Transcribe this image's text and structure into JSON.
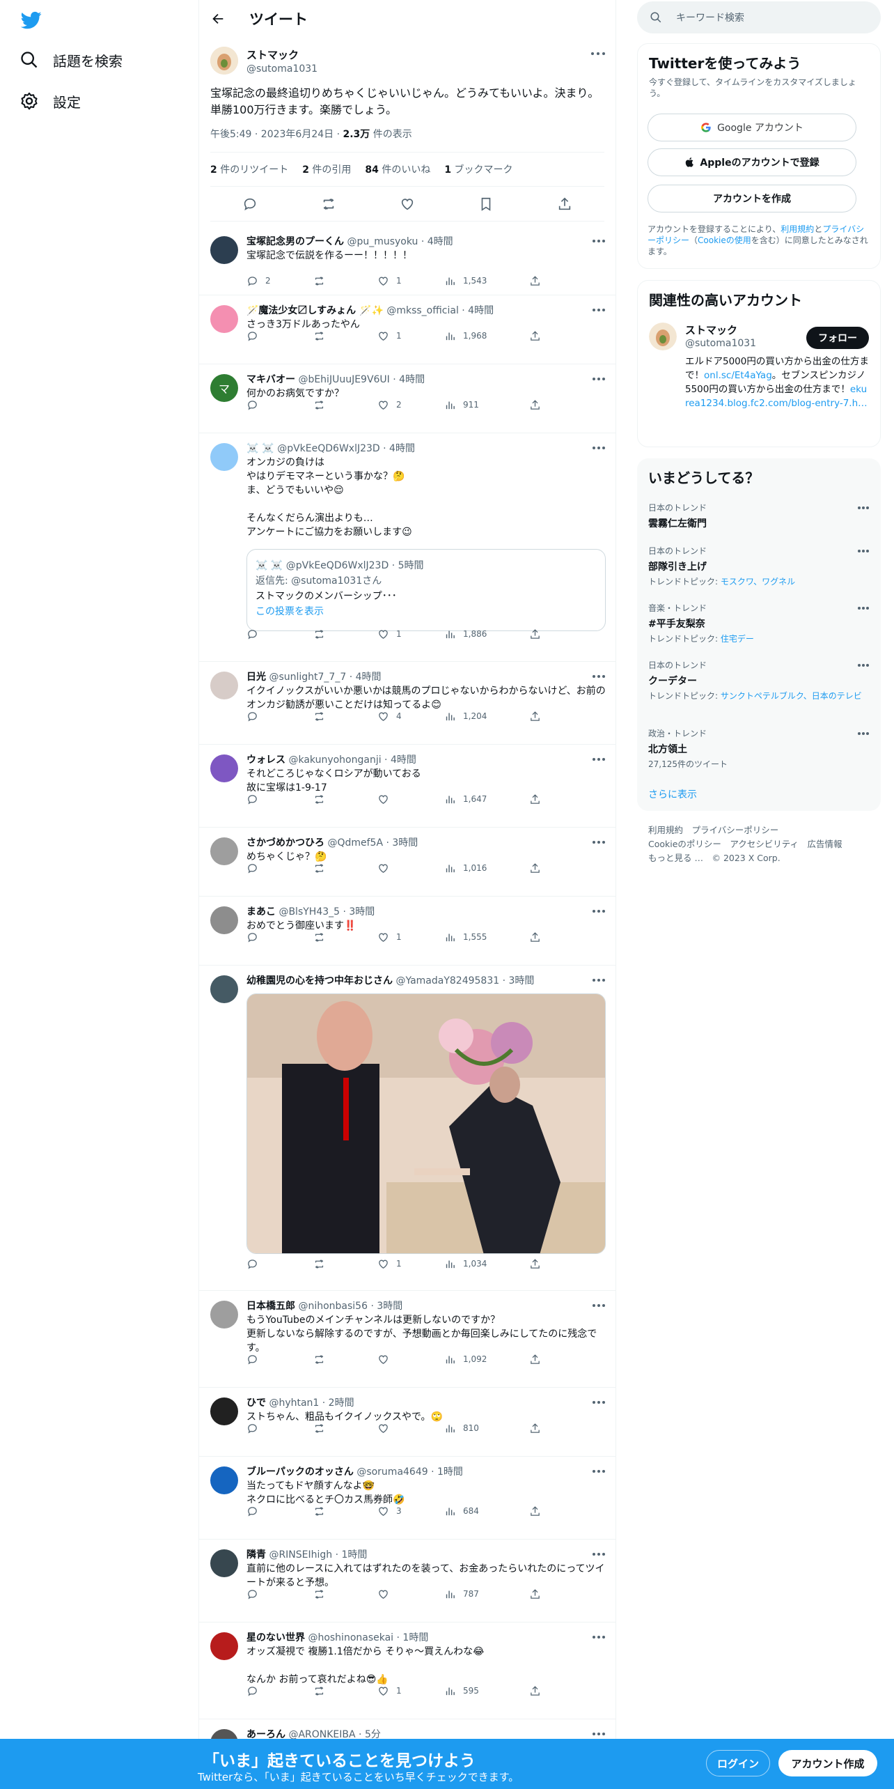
{
  "nav": {
    "explore": "話題を検索",
    "settings": "設定"
  },
  "header": {
    "title": "ツイート"
  },
  "focal": {
    "name": "ストマック",
    "handle": "@sutoma1031",
    "text": "宝塚記念の最終追切りめちゃくじゃいいじゃん。どうみてもいいよ。決まり。単勝100万行きます。楽勝でしょう。",
    "time": "午後5:49 · 2023年6月24日 · ",
    "views_num": "2.3万",
    "views_label": " 件の表示",
    "retweets_num": "2",
    "retweets_label": " 件のリツイート",
    "quotes_num": "2",
    "quotes_label": " 件の引用",
    "likes_num": "84",
    "likes_label": " 件のいいね",
    "bookmarks_num": "1",
    "bookmarks_label": " ブックマーク"
  },
  "replies": [
    {
      "name": "宝塚記念男のプーくん",
      "handle": "@pu_musyoku · 4時間",
      "text": "宝塚記念で伝説を作るーー！！！！！",
      "replies": "2",
      "likes": "1",
      "views": "1,543",
      "avatar_color": "#2c3e50"
    },
    {
      "name": "🪄魔法少女〼しすみょん 🪄✨",
      "handle": "@mkss_official · 4時間",
      "text": "さっき3万ドルあったやん",
      "replies": "",
      "likes": "1",
      "views": "1,968",
      "avatar_color": "#f48fb1"
    },
    {
      "name": "マキバオー",
      "handle": "@bEhiJUuuJE9V6UI · 4時間",
      "text": "何かのお病気ですか？",
      "replies": "",
      "likes": "2",
      "views": "911",
      "avatar_color": "#2e7d32",
      "avatar_letter": "マ"
    },
    {
      "name": "☠️ ☠️",
      "handle": "@pVkEeQD6WxlJ23D · 4時間",
      "text": "オンカジの負けは\nやはりデモマネーという事かな？🤔\nま、どうでもいいや😌\n\nそんなくだらん演出よりも…\nアンケートにご協力をお願いします😉",
      "replies": "",
      "likes": "1",
      "views": "1,886",
      "avatar_color": "#90caf9",
      "quote": {
        "head": "☠️ ☠️ @pVkEeQD6WxlJ23D · 5時間",
        "reply_to": "返信先: @sutoma1031さん",
        "text": "ストマックのメンバーシップ･･･",
        "link": "この投票を表示"
      }
    },
    {
      "name": "日光",
      "handle": "@sunlight7_7_7 · 4時間",
      "text": "イクイノックスがいいか悪いかは競馬のプロじゃないからわからないけど、お前のオンカジ勧誘が悪いことだけは知ってるよ😊",
      "replies": "",
      "likes": "4",
      "views": "1,204",
      "avatar_color": "#d7ccc8"
    },
    {
      "name": "ウォレス",
      "handle": "@kakunyohonganji · 4時間",
      "text": "それどころじゃなくロシアが動いておる\n故に宝塚は1-9-17",
      "replies": "",
      "likes": "",
      "views": "1,647",
      "avatar_color": "#7e57c2"
    },
    {
      "name": "さかづめかつひろ",
      "handle": "@Qdmef5A · 3時間",
      "text": "めちゃくじゃ？🤔",
      "replies": "",
      "likes": "",
      "views": "1,016",
      "avatar_color": "#9e9e9e"
    },
    {
      "name": "まあこ",
      "handle": "@BlsYH43_5 · 3時間",
      "text": "おめでとう御座います‼️",
      "replies": "",
      "likes": "1",
      "views": "1,555",
      "avatar_color": "#8d8d8d"
    },
    {
      "name": "幼稚園児の心を持つ中年おじさん",
      "handle": "@YamadaY82495831 · 3時間",
      "text": "",
      "replies": "",
      "likes": "1",
      "views": "1,034",
      "avatar_color": "#455a64"
    },
    {
      "name": "日本橋五郎",
      "handle": "@nihonbasi56 · 3時間",
      "text": "もうYouTubeのメインチャンネルは更新しないのですか？\n更新しないなら解除するのですが、予想動画とか毎回楽しみにしてたのに残念です。",
      "replies": "",
      "likes": "",
      "views": "1,092",
      "avatar_color": "#9e9e9e"
    },
    {
      "name": "ひで",
      "handle": "@hyhtan1 · 2時間",
      "text": "ストちゃん、粗品もイクイノックスやで。🙄",
      "replies": "",
      "likes": "",
      "views": "810",
      "avatar_color": "#212121"
    },
    {
      "name": "ブルーパックのオッさん",
      "handle": "@soruma4649 · 1時間",
      "text": "当たってもドヤ顔すんなよ🤓\nネクロに比べるとチ〇カス馬券師🤣",
      "replies": "",
      "likes": "3",
      "views": "684",
      "avatar_color": "#1565c0"
    },
    {
      "name": "隣青",
      "handle": "@RINSEIhigh · 1時間",
      "text": "直前に他のレースに入れてはずれたのを装って、お金あったらいれたのにってツイートが来ると予想。",
      "replies": "",
      "likes": "",
      "views": "787",
      "avatar_color": "#37474f"
    },
    {
      "name": "星のない世界",
      "handle": "@hoshinonasekai · 1時間",
      "text": "オッズ凝視で 複勝1.1倍だから そりゃ〜買えんわな😂\n\nなんか お前って哀れだよね😎👍",
      "replies": "",
      "likes": "1",
      "views": "595",
      "avatar_color": "#b71c1c"
    },
    {
      "name": "あーろん",
      "handle": "@ARONKEIBA · 5分",
      "text": "",
      "replies": "",
      "likes": "",
      "views": "",
      "avatar_color": "#555555"
    }
  ],
  "right": {
    "search_placeholder": "キーワード検索",
    "signup_card": {
      "title": "Twitterを使ってみよう",
      "subtitle": "今すぐ登録して、タイムラインをカスタマイズしましょう。",
      "google": "Google アカウント",
      "apple": "Appleのアカウントで登録",
      "create": "アカウントを作成",
      "legal_1": "アカウントを登録することにより、",
      "legal_terms": "利用規約",
      "legal_2": "と",
      "legal_privacy": "プライバシーポリシー",
      "legal_3": "（",
      "legal_cookie": "Cookieの使用",
      "legal_4": "を含む）に同意したとみなされます。"
    },
    "related": {
      "title": "関連性の高いアカウント",
      "name": "ストマック",
      "handle": "@sutoma1031",
      "follow": "フォロー",
      "bio_1": "エルドア5000円の買い方から出金の仕方まで！",
      "bio_link1": "onl.sc/Et4aYag",
      "bio_2": "。セブンスピンカジノ5500円の買い方から出金の仕方まで！",
      "bio_link2": "ekurea1234.blog.fc2.com/blog-entry-7.h…"
    },
    "trends": {
      "title": "いまどうしてる？",
      "items": [
        {
          "cat": "日本のトレンド",
          "name": "雲霧仁左衛門",
          "sub": "",
          "sub_link": ""
        },
        {
          "cat": "日本のトレンド",
          "name": "部隊引き上げ",
          "sub": "トレンドトピック: ",
          "sub_link": "モスクワ、ワグネル"
        },
        {
          "cat": "音楽・トレンド",
          "name": "#平手友梨奈",
          "sub": "トレンドトピック: ",
          "sub_link": "住宅デー"
        },
        {
          "cat": "日本のトレンド",
          "name": "クーデター",
          "sub": "トレンドトピック: ",
          "sub_link": "サンクトペテルブルク、日本のテレビ"
        },
        {
          "cat": "政治・トレンド",
          "name": "北方領土",
          "sub": "27,125件のツイート",
          "sub_link": ""
        }
      ],
      "show_more": "さらに表示"
    },
    "footer": {
      "line1": "利用規約　プライバシーポリシー",
      "line2": "Cookieのポリシー　アクセシビリティ　広告情報",
      "line3": "もっと見る …　© 2023 X Corp."
    }
  },
  "bottom": {
    "title": "「いま」起きていることを見つけよう",
    "subtitle": "Twitterなら、「いま」起きていることをいち早くチェックできます。",
    "login": "ログイン",
    "signup": "アカウント作成"
  },
  "colors": {
    "accent": "#1d9bf0",
    "text": "#0f1419",
    "secondary": "#536471"
  }
}
